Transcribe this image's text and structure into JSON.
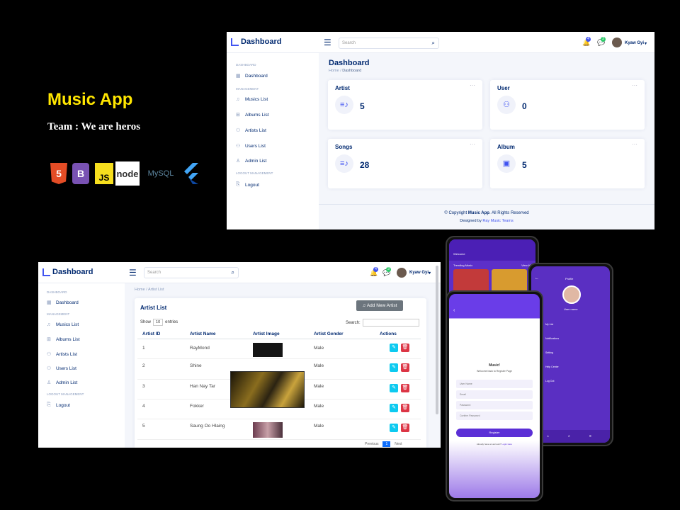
{
  "promo": {
    "title": "Music App",
    "team": "Team : We are heros",
    "tech": [
      "5",
      "B",
      "JS",
      "node",
      "MySQL",
      "F"
    ]
  },
  "dashboard": {
    "logo": "Dashboard",
    "search_placeholder": "Search",
    "notif_count": "4",
    "msg_count": "3",
    "user_name": "Kyaw Gyi",
    "sidebar": {
      "heading_dashboard": "DASHBOARD",
      "heading_management": "MANAGEMENT",
      "heading_logout": "LOGOUT MANAGEMENT",
      "items": [
        "Dashboard",
        "Musics List",
        "Albums List",
        "Artists List",
        "Users List",
        "Admin List",
        "Logout"
      ]
    },
    "page_title": "Dashboard",
    "breadcrumb_home": "Home",
    "breadcrumb_current": "Dashboard",
    "cards": [
      {
        "title": "Artist",
        "value": "5"
      },
      {
        "title": "User",
        "value": "0"
      },
      {
        "title": "Songs",
        "value": "28"
      },
      {
        "title": "Album",
        "value": "5"
      }
    ],
    "footer_copy_prefix": "© Copyright",
    "footer_brand": "Music App",
    "footer_copy_suffix": ". All Rights Reserved",
    "footer_designed_prefix": "Designed by",
    "footer_designer": "Ray Music Teams"
  },
  "artists": {
    "logo": "Dashboard",
    "search_placeholder": "Search",
    "notif_count": "4",
    "msg_count": "3",
    "user_name": "Kyaw Gyi",
    "breadcrumb_home": "Home",
    "breadcrumb_current": "Artist List",
    "card_title": "Artist List",
    "add_button": "Add New Artist",
    "show_label": "Show",
    "show_value": "10",
    "entries_label": "entries",
    "search_label": "Search:",
    "columns": [
      "Artist ID",
      "Artist Name",
      "Artist Image",
      "Artist Gender",
      "Actions"
    ],
    "rows": [
      {
        "id": "1",
        "name": "RayMond",
        "gender": "Male"
      },
      {
        "id": "2",
        "name": "Shine",
        "gender": "Male"
      },
      {
        "id": "3",
        "name": "Han Nay Tar",
        "gender": "Male"
      },
      {
        "id": "4",
        "name": "Fokker",
        "gender": "Male"
      },
      {
        "id": "5",
        "name": "Saung Oo Hlaing",
        "gender": "Male"
      }
    ],
    "pager_prev": "Previous",
    "pager_page": "1",
    "pager_next": "Next"
  },
  "phones": {
    "home": {
      "welcome": "Welcome",
      "trending": "Trending Music",
      "view_all": "View All"
    },
    "profile": {
      "title": "Profile",
      "user_name": "User name",
      "menu": [
        "My List",
        "Notifications",
        "Setting",
        "Help Center",
        "Log Out"
      ]
    },
    "register": {
      "title": "Music!",
      "subtitle": "Welcome back to Register Page",
      "fields": [
        "User Name",
        "Email",
        "Password",
        "Confirm Password"
      ],
      "button": "Register",
      "footer": "Already have an account?",
      "login": "Login Here"
    }
  },
  "colors": {
    "primary": "#012970",
    "accent": "#4154f1",
    "purple": "#6a3de8",
    "yellow": "#ffe600"
  }
}
